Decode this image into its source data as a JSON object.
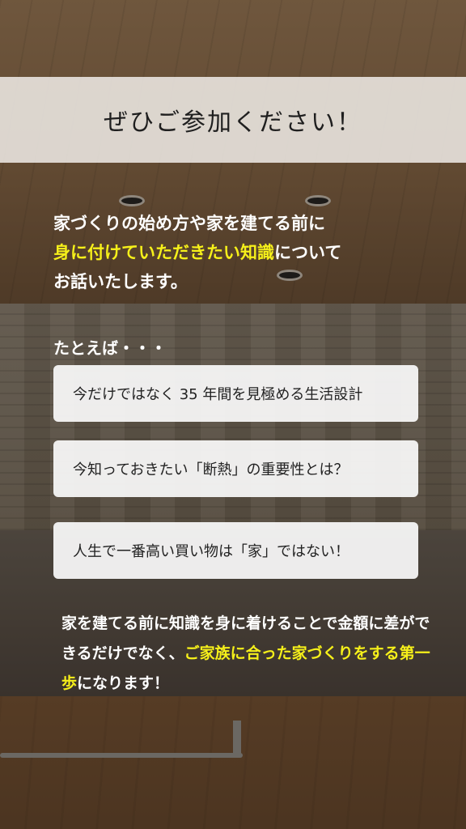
{
  "title": "ぜひご参加ください！",
  "intro": {
    "line1": "家づくりの始め方や家を建てる前に",
    "highlight": "身に付けていただきたい知識",
    "line2_rest": "について",
    "line3": "お話いたします。"
  },
  "examples": {
    "heading": "たとえば・・・",
    "items": [
      "今だけではなく 35 年間を見極める生活設計",
      "今知っておきたい「断熱」の重要性とは？",
      "人生で一番高い買い物は「家」ではない！"
    ]
  },
  "outro": {
    "part1": "家を建てる前に知識を身に着けることで金額に差ができるだけでなく、",
    "highlight": "ご家族に合った家づくりをする第一歩",
    "part2": "になります！"
  },
  "colors": {
    "highlight": "#f6f01a",
    "text_light": "#ffffff",
    "title_band": "#f0ece8"
  }
}
